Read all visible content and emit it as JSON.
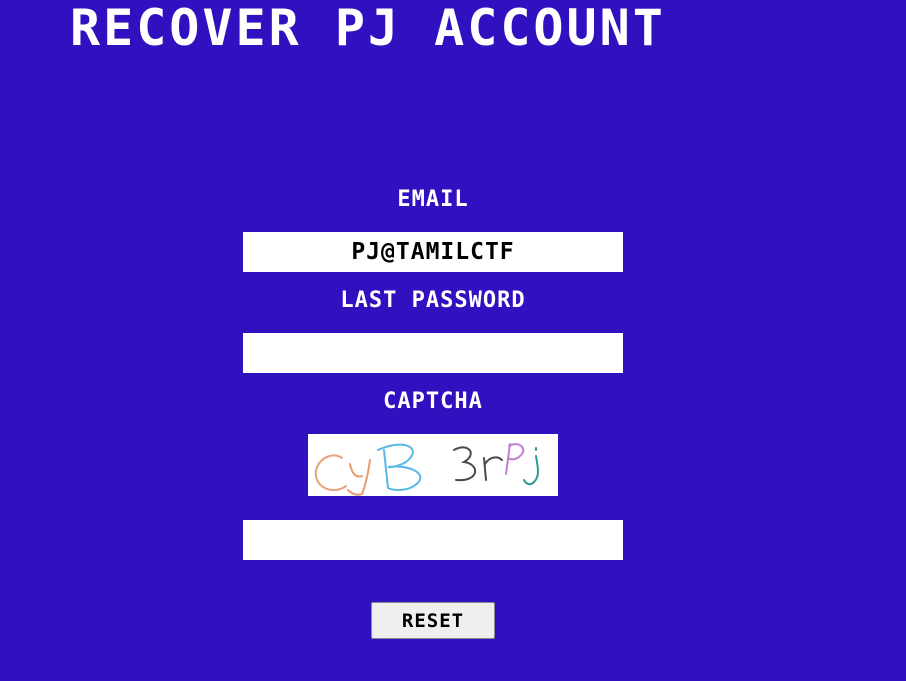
{
  "page": {
    "title": "RECOVER PJ ACCOUNT",
    "background_color": "#3110c0"
  },
  "form": {
    "email_label": "EMAIL",
    "email_value": "PJ@TAMILCTF",
    "last_password_label": "LAST PASSWORD",
    "last_password_value": "",
    "captcha_label": "CAPTCHA",
    "captcha_text": "CyB3rPj",
    "captcha_input_value": "",
    "reset_label": "RESET"
  },
  "colors": {
    "text": "#ffffff",
    "field_background": "#ffffff",
    "button_background": "#efefef"
  }
}
